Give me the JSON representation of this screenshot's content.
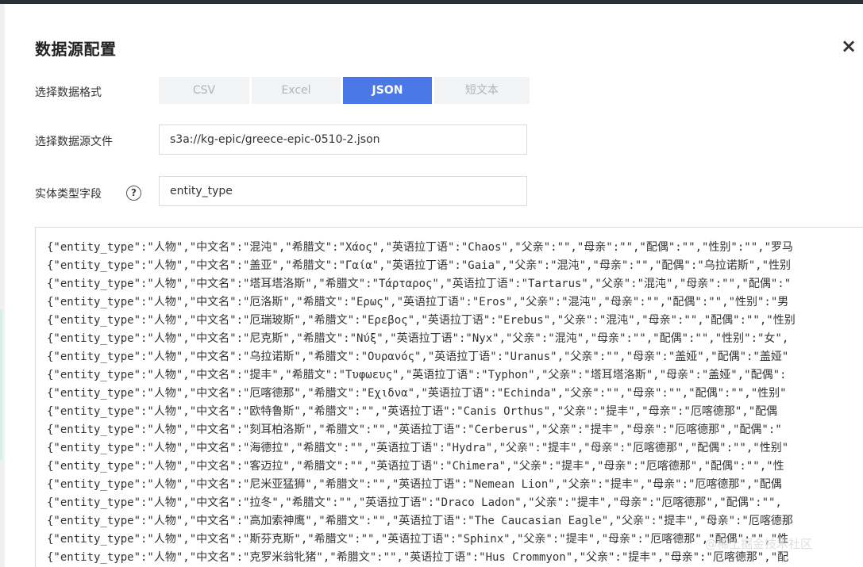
{
  "dialog": {
    "title": "数据源配置",
    "close_icon": "×"
  },
  "format": {
    "label": "选择数据格式",
    "options": [
      "CSV",
      "Excel",
      "JSON",
      "短文本"
    ],
    "selected": "JSON"
  },
  "file": {
    "label": "选择数据源文件",
    "value": "s3a://kg-epic/greece-epic-0510-2.json"
  },
  "entity_field": {
    "label": "实体类型字段",
    "help_icon": "?",
    "value": "entity_type"
  },
  "preview_lines": [
    "{\"entity_type\":\"人物\",\"中文名\":\"混沌\",\"希腊文\":\"Χάος\",\"英语拉丁语\":\"Chaos\",\"父亲\":\"\",\"母亲\":\"\",\"配偶\":\"\",\"性别\":\"\",\"罗马",
    "{\"entity_type\":\"人物\",\"中文名\":\"盖亚\",\"希腊文\":\"Γαία\",\"英语拉丁语\":\"Gaia\",\"父亲\":\"混沌\",\"母亲\":\"\",\"配偶\":\"乌拉诺斯\",\"性别",
    "{\"entity_type\":\"人物\",\"中文名\":\"塔耳塔洛斯\",\"希腊文\":\"Τάρταρος\",\"英语拉丁语\":\"Tartarus\",\"父亲\":\"混沌\",\"母亲\":\"\",\"配偶\":\"",
    "{\"entity_type\":\"人物\",\"中文名\":\"厄洛斯\",\"希腊文\":\"Ερως\",\"英语拉丁语\":\"Eros\",\"父亲\":\"混沌\",\"母亲\":\"\",\"配偶\":\"\",\"性别\":\"男",
    "{\"entity_type\":\"人物\",\"中文名\":\"厄瑞玻斯\",\"希腊文\":\"Ερεβος\",\"英语拉丁语\":\"Erebus\",\"父亲\":\"混沌\",\"母亲\":\"\",\"配偶\":\"\",\"性别",
    "{\"entity_type\":\"人物\",\"中文名\":\"尼克斯\",\"希腊文\":\"Νύξ\",\"英语拉丁语\":\"Nyx\",\"父亲\":\"混沌\",\"母亲\":\"\",\"配偶\":\"\",\"性别\":\"女\",",
    "{\"entity_type\":\"人物\",\"中文名\":\"乌拉诺斯\",\"希腊文\":\"Ουρανός\",\"英语拉丁语\":\"Uranus\",\"父亲\":\"\",\"母亲\":\"盖娅\",\"配偶\":\"盖娅\"",
    "{\"entity_type\":\"人物\",\"中文名\":\"提丰\",\"希腊文\":\"Τυφωευς\",\"英语拉丁语\":\"Typhon\",\"父亲\":\"塔耳塔洛斯\",\"母亲\":\"盖娅\",\"配偶\":",
    "{\"entity_type\":\"人物\",\"中文名\":\"厄喀德那\",\"希腊文\":\"Εχιδνα\",\"英语拉丁语\":\"Echinda\",\"父亲\":\"\",\"母亲\":\"\",\"配偶\":\"\",\"性别\"",
    "{\"entity_type\":\"人物\",\"中文名\":\"欧特鲁斯\",\"希腊文\":\"\",\"英语拉丁语\":\"Canis Orthus\",\"父亲\":\"提丰\",\"母亲\":\"厄喀德那\",\"配偶",
    "{\"entity_type\":\"人物\",\"中文名\":\"刻耳柏洛斯\",\"希腊文\":\"\",\"英语拉丁语\":\"Cerberus\",\"父亲\":\"提丰\",\"母亲\":\"厄喀德那\",\"配偶\":\"",
    "{\"entity_type\":\"人物\",\"中文名\":\"海德拉\",\"希腊文\":\"\",\"英语拉丁语\":\"Hydra\",\"父亲\":\"提丰\",\"母亲\":\"厄喀德那\",\"配偶\":\"\",\"性别\"",
    "{\"entity_type\":\"人物\",\"中文名\":\"客迈拉\",\"希腊文\":\"\",\"英语拉丁语\":\"Chimera\",\"父亲\":\"提丰\",\"母亲\":\"厄喀德那\",\"配偶\":\"\",\"性",
    "{\"entity_type\":\"人物\",\"中文名\":\"尼米亚猛狮\",\"希腊文\":\"\",\"英语拉丁语\":\"Nemean Lion\",\"父亲\":\"提丰\",\"母亲\":\"厄喀德那\",\"配偶",
    "{\"entity_type\":\"人物\",\"中文名\":\"拉冬\",\"希腊文\":\"\",\"英语拉丁语\":\"Draco Ladon\",\"父亲\":\"提丰\",\"母亲\":\"厄喀德那\",\"配偶\":\"\",",
    "{\"entity_type\":\"人物\",\"中文名\":\"高加索神鹰\",\"希腊文\":\"\",\"英语拉丁语\":\"The Caucasian Eagle\",\"父亲\":\"提丰\",\"母亲\":\"厄喀德那",
    "{\"entity_type\":\"人物\",\"中文名\":\"斯芬克斯\",\"希腊文\":\"\",\"英语拉丁语\":\"Sphinx\",\"父亲\":\"提丰\",\"母亲\":\"厄喀德那\",\"配偶\":\"\",\"性",
    "{\"entity_type\":\"人物\",\"中文名\":\"克罗米翁牝猪\",\"希腊文\":\"\",\"英语拉丁语\":\"Hus Crommyon\",\"父亲\":\"提丰\",\"母亲\":\"厄喀德那\",\"配"
  ],
  "watermark": "@稀土掘金技术社区"
}
